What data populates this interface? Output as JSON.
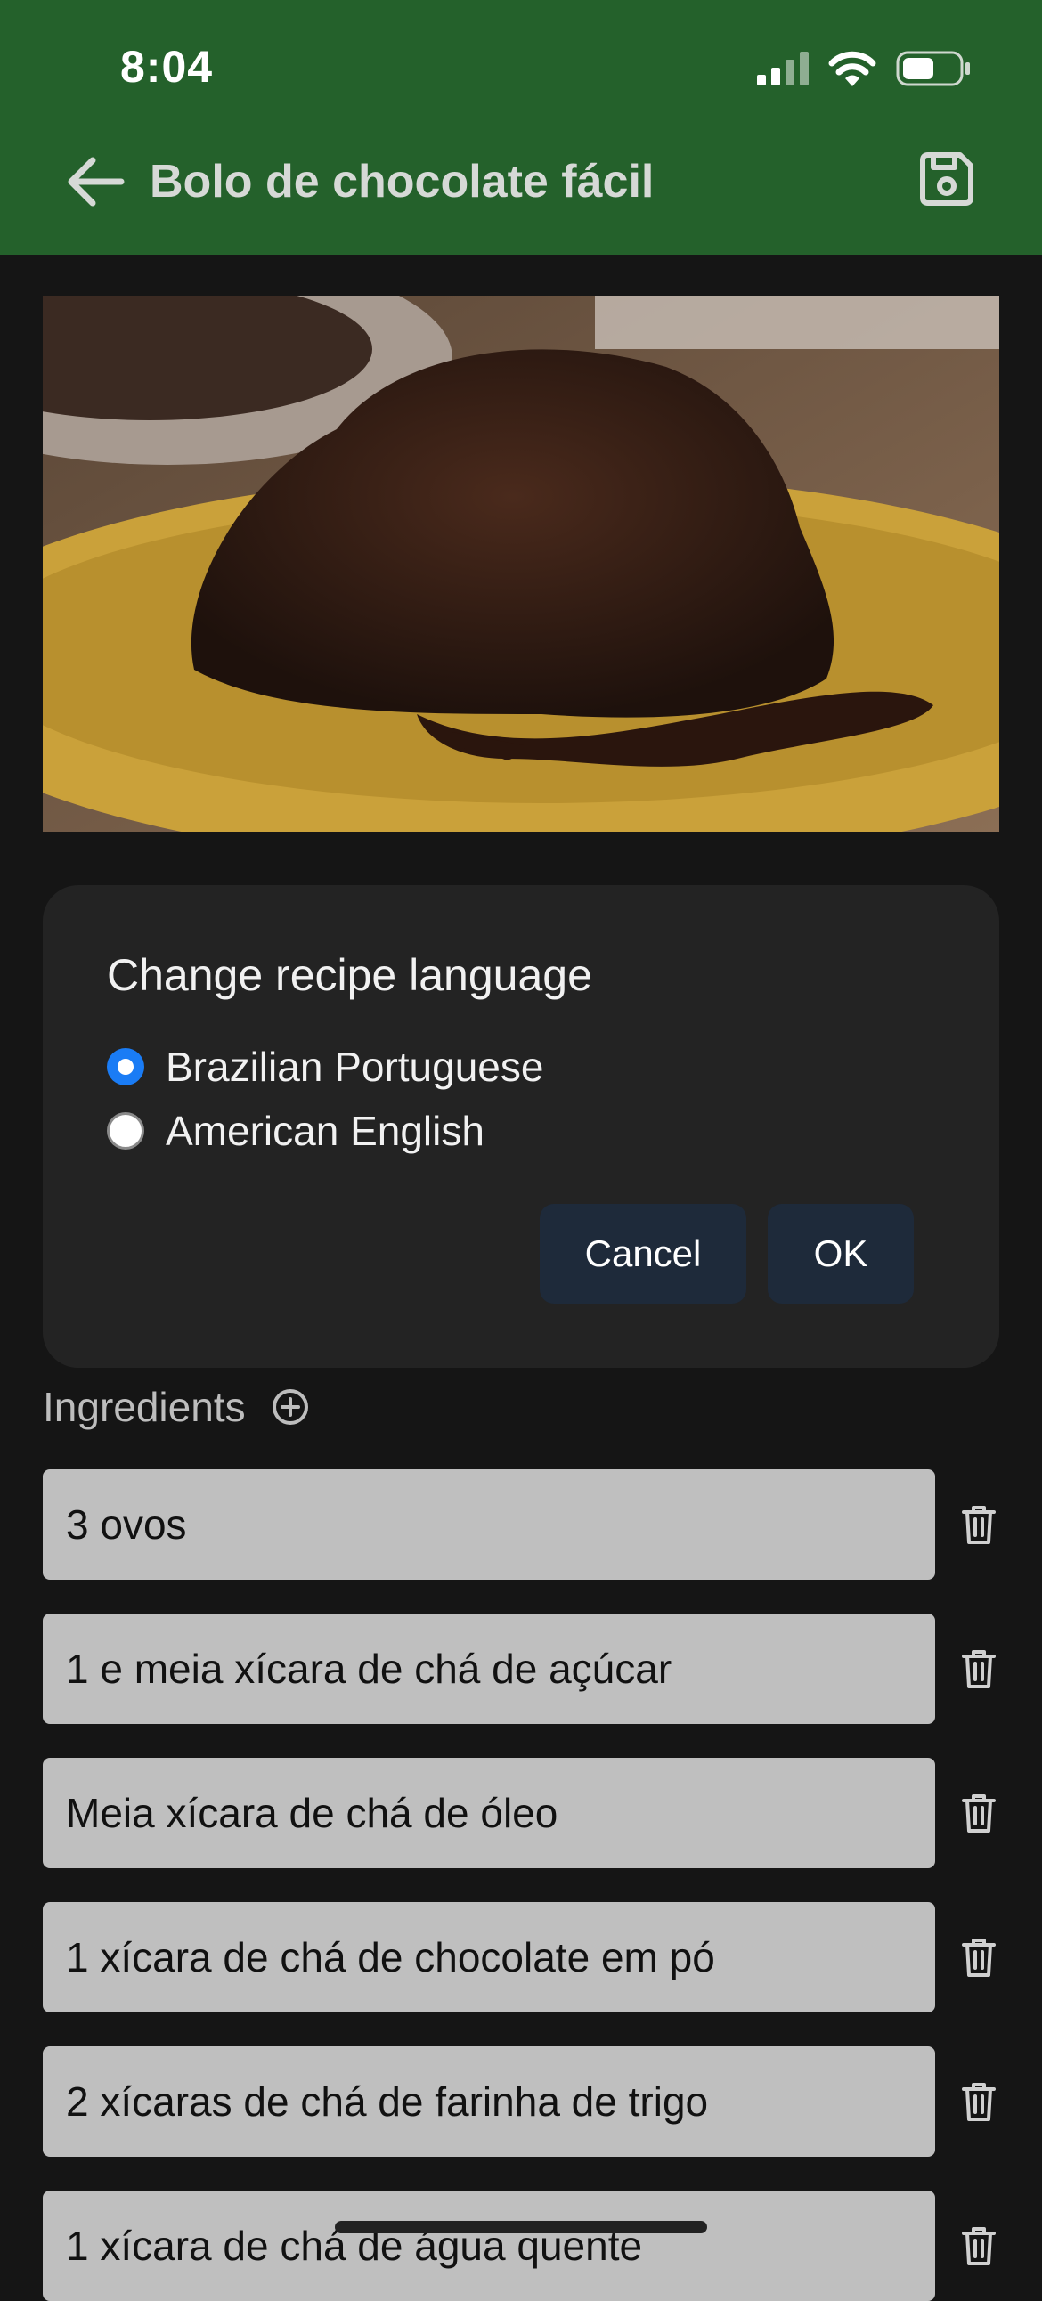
{
  "status_bar": {
    "time": "8:04"
  },
  "app_bar": {
    "title": "Bolo de chocolate fácil"
  },
  "dialog": {
    "title": "Change recipe language",
    "options": [
      {
        "label": "Brazilian Portuguese",
        "selected": true
      },
      {
        "label": "American English",
        "selected": false
      }
    ],
    "cancel_label": "Cancel",
    "ok_label": "OK"
  },
  "ingredients": {
    "heading": "Ingredients",
    "items": [
      "3 ovos",
      "1 e meia xícara de chá de açúcar",
      "Meia xícara de chá de óleo",
      "1 xícara de chá de chocolate em pó",
      "2 xícaras de chá de farinha de trigo",
      "1 xícara de chá de água quente"
    ]
  },
  "colors": {
    "app_bar": "#24612b",
    "background": "#151515",
    "dialog": "#232323",
    "radio_selected": "#1a7cf5",
    "dialog_button": "#1e2a3a",
    "ingredient_field": "#bfbfbf"
  },
  "icons": [
    "back-arrow-icon",
    "save-icon",
    "add-circle-icon",
    "trash-icon",
    "signal-icon",
    "wifi-icon",
    "battery-icon"
  ]
}
